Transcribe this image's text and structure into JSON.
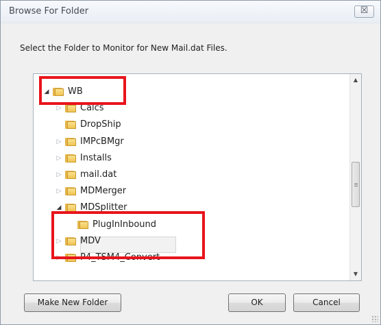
{
  "window": {
    "title": "Browse For Folder",
    "close_glyph": "☒"
  },
  "instruction": "Select the Folder to Monitor for New Mail.dat Files.",
  "tree": {
    "items": [
      {
        "label": "WB",
        "expander": "open",
        "level": 0,
        "icon": "folder-icon"
      },
      {
        "label": "Calcs",
        "expander": "collapsed",
        "level": 1,
        "icon": "folder-icon"
      },
      {
        "label": "DropShip",
        "expander": "none",
        "level": 1,
        "icon": "folder-icon"
      },
      {
        "label": "IMPcBMgr",
        "expander": "collapsed",
        "level": 1,
        "icon": "folder-icon"
      },
      {
        "label": "Installs",
        "expander": "collapsed",
        "level": 1,
        "icon": "folder-icon"
      },
      {
        "label": "mail.dat",
        "expander": "collapsed",
        "level": 1,
        "icon": "folder-icon"
      },
      {
        "label": "MDMerger",
        "expander": "collapsed",
        "level": 1,
        "icon": "folder-icon"
      },
      {
        "label": "MDSplitter",
        "expander": "open",
        "level": 1,
        "icon": "folder-icon"
      },
      {
        "label": "PlugInInbound",
        "expander": "none",
        "level": 2,
        "icon": "folder-icon",
        "selected": true
      },
      {
        "label": "MDV",
        "expander": "collapsed",
        "level": 1,
        "icon": "folder-icon"
      },
      {
        "label": "P4_TSM4_Convert",
        "expander": "collapsed",
        "level": 1,
        "icon": "folder-icon"
      }
    ]
  },
  "buttons": {
    "make_new_folder": "Make New Folder",
    "ok": "OK",
    "cancel": "Cancel"
  },
  "colors": {
    "highlight": "#e8141c",
    "folder": "#f0c453"
  }
}
